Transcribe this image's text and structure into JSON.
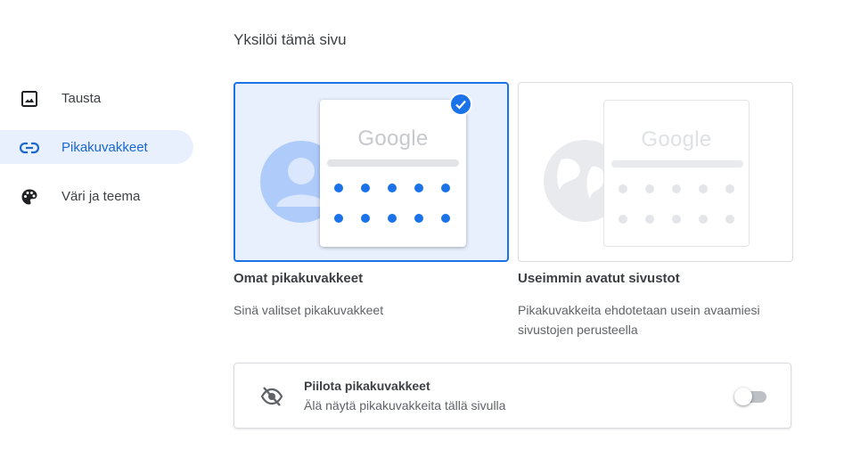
{
  "page": {
    "heading": "Yksilöi tämä sivu"
  },
  "sidebar": {
    "items": [
      {
        "label": "Tausta",
        "icon": "image-icon",
        "active": false
      },
      {
        "label": "Pikakuvakkeet",
        "icon": "link-icon",
        "active": true
      },
      {
        "label": "Väri ja teema",
        "icon": "palette-icon",
        "active": false
      }
    ]
  },
  "options": [
    {
      "title": "Omat pikakuvakkeet",
      "description": "Sinä valitset pikakuvakkeet",
      "logo_text": "Google",
      "selected": true
    },
    {
      "title": "Useimmin avatut sivustot",
      "description_line1": "Pikakuvakkeita ehdotetaan usein avaamiesi",
      "description_line2": "sivustojen perusteella",
      "logo_text": "Google",
      "selected": false
    }
  ],
  "hide_shortcuts": {
    "title": "Piilota pikakuvakkeet",
    "description": "Älä näytä pikakuvakkeita tällä sivulla",
    "icon": "eye-off-icon",
    "enabled": false
  },
  "colors": {
    "accent": "#1a73e8",
    "active_bg": "#e8f0fe",
    "active_text": "#1967d2",
    "text": "#3c4043",
    "secondary_text": "#5f6368"
  }
}
